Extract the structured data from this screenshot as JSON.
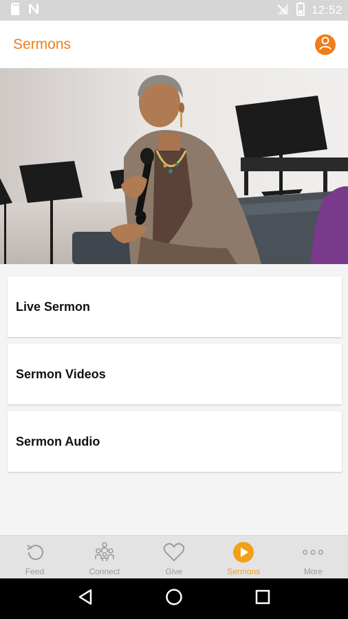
{
  "status_bar": {
    "time": "12:52",
    "icons": [
      "sd-card-icon",
      "n-notification-icon",
      "no-signal-icon",
      "battery-icon"
    ]
  },
  "app_bar": {
    "title": "Sermons",
    "profile_icon": "account-circle-icon"
  },
  "hero": {
    "image_subject": "woman speaking into microphone on stage"
  },
  "menu": {
    "items": [
      {
        "label": "Live Sermon"
      },
      {
        "label": "Sermon Videos"
      },
      {
        "label": "Sermon Audio"
      }
    ]
  },
  "bottom_nav": {
    "items": [
      {
        "label": "Feed",
        "icon": "refresh-history-icon"
      },
      {
        "label": "Connect",
        "icon": "people-group-icon"
      },
      {
        "label": "Give",
        "icon": "heart-icon"
      },
      {
        "label": "Sermons",
        "icon": "play-circle-icon"
      },
      {
        "label": "More",
        "icon": "more-dots-icon"
      }
    ],
    "active": "Sermons"
  },
  "colors": {
    "accent": "#f07d1a",
    "active_tab": "#f0a118",
    "inactive_tab": "#9b9b9b"
  }
}
